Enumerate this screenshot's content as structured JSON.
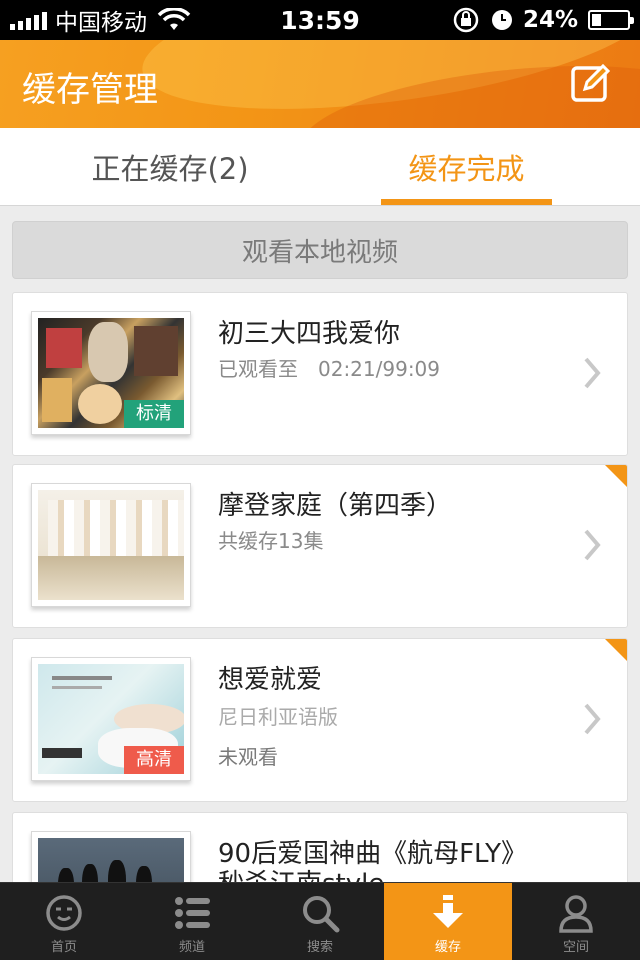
{
  "status_bar": {
    "carrier": "中国移动",
    "time": "13:59",
    "battery": "24%",
    "battery_level": 0.24,
    "icons": [
      "signal-icon",
      "wifi-icon",
      "rotation-lock-icon",
      "alarm-icon",
      "battery-icon"
    ]
  },
  "header": {
    "title": "缓存管理",
    "edit_icon": "edit-icon",
    "colors": {
      "accent": "#f39516",
      "accent_dark": "#ec7a13"
    }
  },
  "tabs": [
    {
      "label": "正在缓存(2)",
      "active": false
    },
    {
      "label": "缓存完成",
      "active": true
    }
  ],
  "local_bar": {
    "label": "观看本地视频"
  },
  "items": [
    {
      "title": "初三大四我爱你",
      "line1": "已观看至　02:21/99:09",
      "line2": "",
      "badge": "标清",
      "badge_color": "#22a27a",
      "new_corner": false
    },
    {
      "title": "摩登家庭（第四季）",
      "line1": "共缓存13集",
      "line2": "",
      "badge": "",
      "badge_color": "",
      "new_corner": true
    },
    {
      "title": "想爱就爱",
      "line1": "尼日利亚语版",
      "line2": "未观看",
      "badge": "高清",
      "badge_color": "#ef5b4b",
      "new_corner": true
    },
    {
      "title": "90后爱国神曲《航母FLY》",
      "title2": "秒杀江南style",
      "line1": "",
      "line2": "",
      "badge": "",
      "badge_color": "",
      "new_corner": false
    }
  ],
  "bottom_nav": [
    {
      "label": "首页",
      "icon": "home-face-icon",
      "active": false
    },
    {
      "label": "频道",
      "icon": "list-icon",
      "active": false
    },
    {
      "label": "搜索",
      "icon": "search-icon",
      "active": false
    },
    {
      "label": "缓存",
      "icon": "download-icon",
      "active": true
    },
    {
      "label": "空间",
      "icon": "user-icon",
      "active": false
    }
  ]
}
